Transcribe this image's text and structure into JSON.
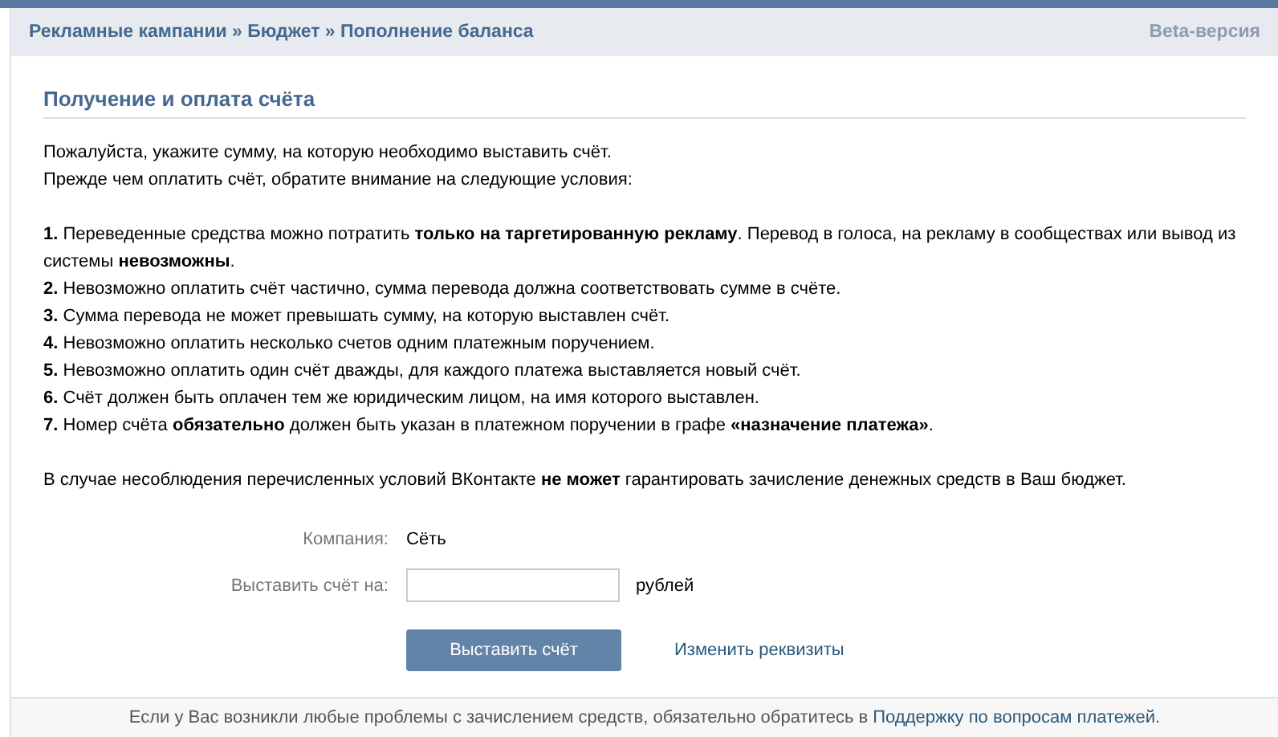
{
  "breadcrumb": "Рекламные кампании » Бюджет » Пополнение баланса",
  "beta_label": "Beta-версия",
  "section_title": "Получение и оплата счёта",
  "intro": [
    "Пожалуйста, укажите сумму, на которую необходимо выставить счёт.",
    "Прежде чем оплатить счёт, обратите внимание на следующие условия:"
  ],
  "conditions": [
    "**1.** Переведенные средства можно потратить **только на таргетированную рекламу**. Перевод в голоса, на рекламу в сообществах или вывод из системы **невозможны**.",
    "**2.** Невозможно оплатить счёт частично, сумма перевода должна соответствовать сумме в счёте.",
    "**3.** Сумма перевода не может превышать сумму, на которую выставлен счёт.",
    "**4.** Невозможно оплатить несколько счетов одним платежным поручением.",
    "**5.** Невозможно оплатить один счёт дважды, для каждого платежа выставляется новый счёт.",
    "**6.** Счёт должен быть оплачен тем же юридическим лицом, на имя которого выставлен.",
    "**7.** Номер счёта **обязательно** должен быть указан в платежном поручении в графе **«назначение платежа»**."
  ],
  "warning": "В случае несоблюдения перечисленных условий ВКонтакте **не может** гарантировать зачисление денежных средств в Ваш бюджет.",
  "form": {
    "company_label": "Компания:",
    "company_value": "Сёть",
    "amount_label": "Выставить счёт на:",
    "amount_unit": "рублей"
  },
  "submit_button": "Выставить счёт",
  "edit_link": "Изменить реквизиты",
  "footer": {
    "text": "Если у Вас возникли любые проблемы с зачислением средств, обязательно обратитесь в",
    "link": "Поддержку по вопросам платежей",
    "end": "."
  }
}
